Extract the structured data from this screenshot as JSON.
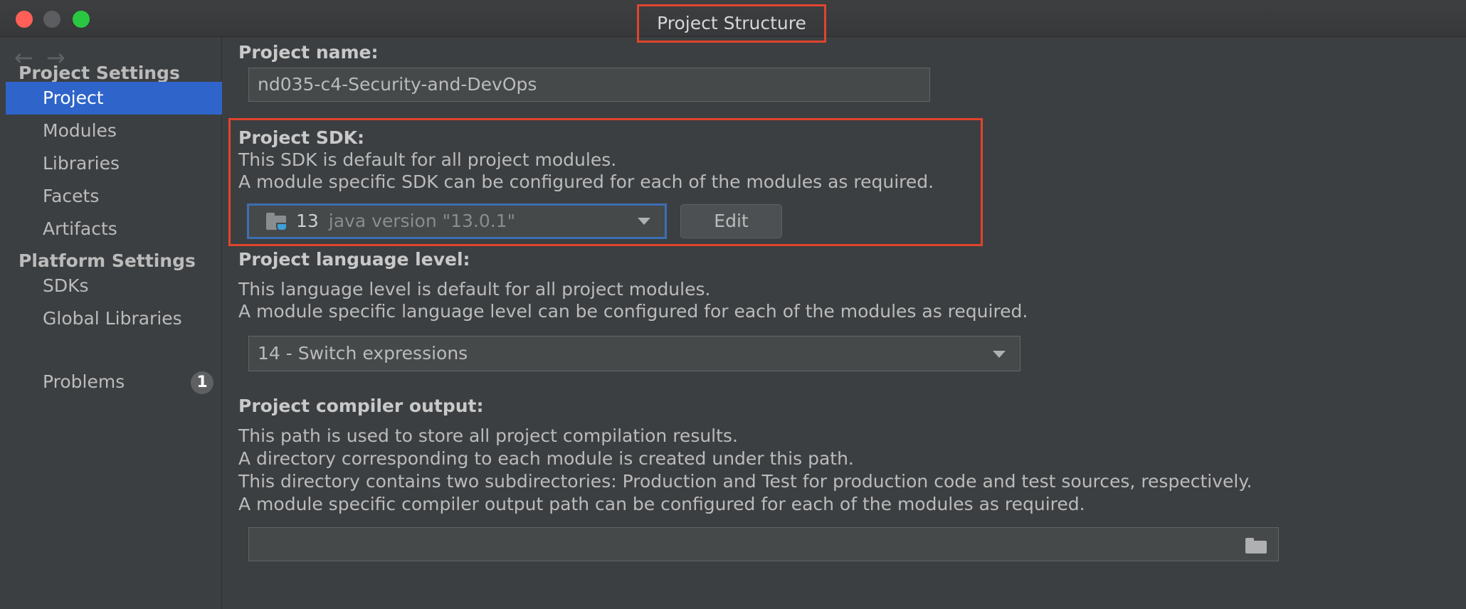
{
  "window": {
    "title": "Project Structure"
  },
  "sidebar": {
    "nav_back": "←",
    "nav_forward": "→",
    "project_settings_title": "Project Settings",
    "platform_settings_title": "Platform Settings",
    "items": [
      {
        "label": "Project",
        "selected": true
      },
      {
        "label": "Modules"
      },
      {
        "label": "Libraries"
      },
      {
        "label": "Facets"
      },
      {
        "label": "Artifacts"
      },
      {
        "label": "SDKs"
      },
      {
        "label": "Global Libraries"
      },
      {
        "label": "Problems",
        "badge": "1"
      }
    ]
  },
  "project_name": {
    "label": "Project name:",
    "value": "nd035-c4-Security-and-DevOps"
  },
  "project_sdk": {
    "label": "Project SDK:",
    "desc1": "This SDK is default for all project modules.",
    "desc2": "A module specific SDK can be configured for each of the modules as required.",
    "selected_version": "13",
    "selected_detail": "java version \"13.0.1\"",
    "edit_label": "Edit",
    "icon": "folder-java-icon"
  },
  "language_level": {
    "label": "Project language level:",
    "desc1": "This language level is default for all project modules.",
    "desc2": "A module specific language level can be configured for each of the modules as required.",
    "selected": "14 - Switch expressions"
  },
  "compiler_output": {
    "label": "Project compiler output:",
    "desc1": "This path is used to store all project compilation results.",
    "desc2": "A directory corresponding to each module is created under this path.",
    "desc3": "This directory contains two subdirectories: Production and Test for production code and test sources, respectively.",
    "desc4": "A module specific compiler output path can be configured for each of the modules as required.",
    "path_value": "",
    "browse_icon": "folder-icon"
  },
  "colors": {
    "background": "#3c3f41",
    "selection": "#2f65ca",
    "highlight_box": "#e0442d"
  }
}
